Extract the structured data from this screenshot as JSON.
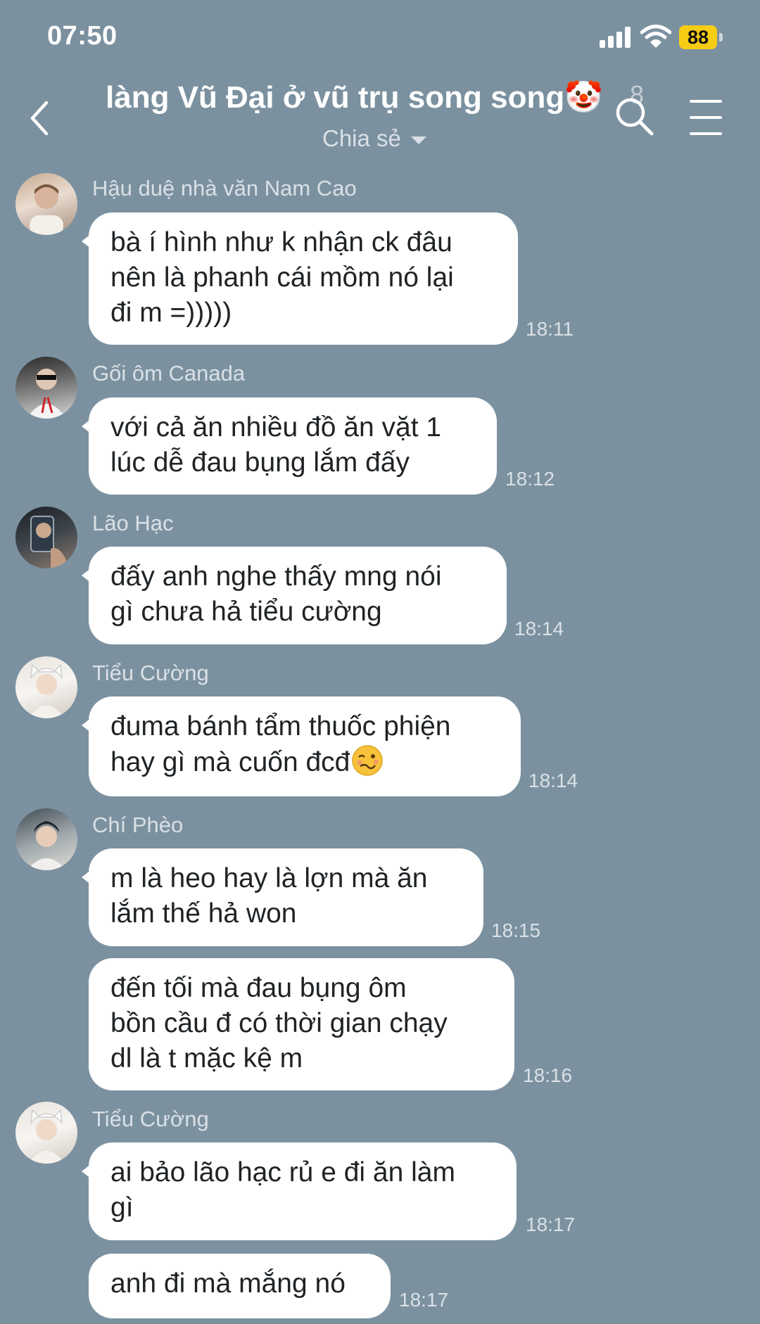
{
  "status_bar": {
    "time": "07:50",
    "battery": "88"
  },
  "header": {
    "title": "làng Vũ Đại ở vũ trụ song song🤡",
    "member_count": "8",
    "subtitle": "Chia sẻ"
  },
  "messages": [
    {
      "sender": "Hậu duệ nhà văn Nam Cao",
      "text": "bà í hình như k nhận ck đâu\nnên là phanh cái mồm nó lại\nđi m =)))))",
      "time": "18:11"
    },
    {
      "sender": "Gối ôm Canada",
      "text": "với cả ăn nhiều đồ ăn vặt 1\nlúc dễ đau bụng lắm đấy",
      "time": "18:12"
    },
    {
      "sender": "Lão Hạc",
      "text": "đấy anh nghe thấy mng nói\ngì chưa hả tiểu cường",
      "time": "18:14"
    },
    {
      "sender": "Tiểu Cường",
      "text": "đuma bánh tẩm thuốc phiện\nhay gì mà cuốn đcđ",
      "emoji": "woozy-face",
      "time": "18:14"
    },
    {
      "sender": "Chí Phèo",
      "text": "m là heo hay là lợn mà ăn\nlắm thế hả won",
      "time": "18:15"
    },
    {
      "text": "đến tối mà đau bụng ôm\nbồn cầu đ có thời gian chạy\ndl là t mặc kệ m",
      "time": "18:16"
    },
    {
      "sender": "Tiểu Cường",
      "text": "ai bảo lão hạc rủ e đi ăn làm\ngì",
      "time": "18:17"
    },
    {
      "text": "anh đi mà mắng nó",
      "time": "18:17"
    }
  ],
  "colors": {
    "background": "#7b91a0",
    "bubble": "#ffffff",
    "battery": "#f6cc15"
  }
}
